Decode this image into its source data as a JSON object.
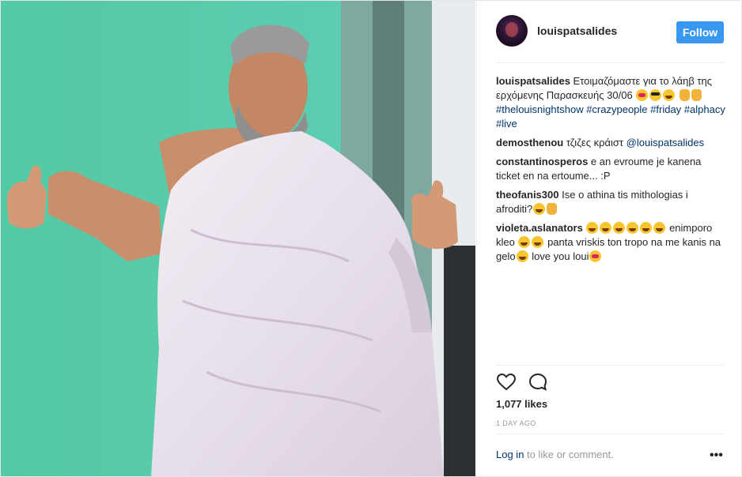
{
  "post": {
    "username": "louispatsalides",
    "follow_label": "Follow",
    "avatar": "profile-avatar"
  },
  "comments": [
    {
      "user": "louispatsalides",
      "parts": [
        {
          "type": "text",
          "value": "Ετοιμαζόμαστε για το λάηβ της ερχόμενης Παρασκευής 30/06 "
        },
        {
          "type": "emoji",
          "kind": "heart"
        },
        {
          "type": "emoji",
          "kind": "cool"
        },
        {
          "type": "emoji",
          "kind": "laugh"
        },
        {
          "type": "text",
          "value": " "
        },
        {
          "type": "hand"
        },
        {
          "type": "hand"
        },
        {
          "type": "text",
          "value": " "
        },
        {
          "type": "tag",
          "value": "#thelouisnightshow"
        },
        {
          "type": "text",
          "value": " "
        },
        {
          "type": "tag",
          "value": "#crazypeople"
        },
        {
          "type": "text",
          "value": " "
        },
        {
          "type": "tag",
          "value": "#friday"
        },
        {
          "type": "text",
          "value": " "
        },
        {
          "type": "tag",
          "value": "#alphacy"
        },
        {
          "type": "text",
          "value": " "
        },
        {
          "type": "tag",
          "value": "#live"
        }
      ]
    },
    {
      "user": "demosthenou",
      "parts": [
        {
          "type": "text",
          "value": "τζιζες κράιστ "
        },
        {
          "type": "tag",
          "value": "@louispatsalides"
        }
      ]
    },
    {
      "user": "constantinosperos",
      "parts": [
        {
          "type": "text",
          "value": "e an evroume je kanena ticket en na ertoume... :P"
        }
      ]
    },
    {
      "user": "theofanis300",
      "parts": [
        {
          "type": "text",
          "value": "Ise o athina tis mithologias i afroditi?"
        },
        {
          "type": "emoji",
          "kind": "laugh"
        },
        {
          "type": "hand"
        }
      ]
    },
    {
      "user": "violeta.aslanators",
      "parts": [
        {
          "type": "text",
          "value": " "
        },
        {
          "type": "emoji",
          "kind": "laugh"
        },
        {
          "type": "emoji",
          "kind": "laugh"
        },
        {
          "type": "emoji",
          "kind": "laugh"
        },
        {
          "type": "emoji",
          "kind": "laugh"
        },
        {
          "type": "emoji",
          "kind": "laugh"
        },
        {
          "type": "emoji",
          "kind": "laugh"
        },
        {
          "type": "text",
          "value": " enimporo kleo "
        },
        {
          "type": "emoji",
          "kind": "laugh"
        },
        {
          "type": "emoji",
          "kind": "laugh"
        },
        {
          "type": "text",
          "value": " panta vriskis ton tropo na me kanis na gelo"
        },
        {
          "type": "emoji",
          "kind": "laugh"
        },
        {
          "type": "text",
          "value": " love you loui"
        },
        {
          "type": "emoji",
          "kind": "heart"
        }
      ]
    }
  ],
  "actions": {
    "like_icon": "heart-icon",
    "comment_icon": "comment-icon"
  },
  "likes_text": "1,077 likes",
  "time_text": "1 DAY AGO",
  "login": {
    "link_text": "Log in",
    "rest_text": " to like or comment."
  },
  "more_label": "•••",
  "colors": {
    "follow_bg": "#3897f0",
    "link": "#003569",
    "muted": "#999999",
    "backdrop": "#57c9a9"
  }
}
